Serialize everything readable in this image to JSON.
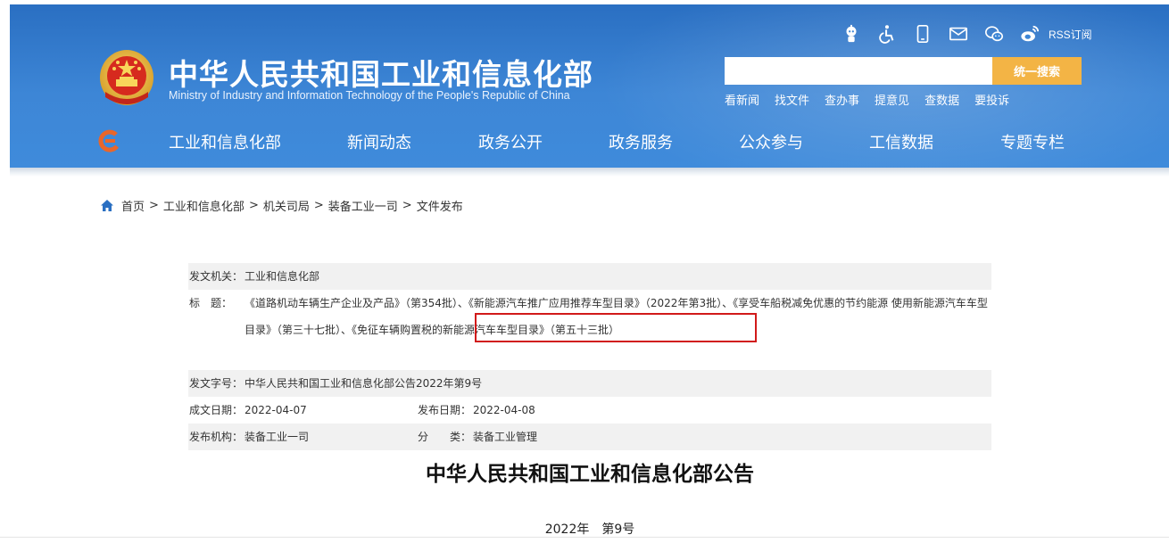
{
  "header": {
    "site_title": "中华人民共和国工业和信息化部",
    "site_subtitle": "Ministry of Industry and Information Technology of the People's Republic of China",
    "tool_icons": [
      "robot-assistant-icon",
      "accessibility-icon",
      "mobile-icon",
      "mail-icon",
      "wechat-icon",
      "weibo-icon"
    ],
    "rss_label": "RSS订阅",
    "search": {
      "placeholder": "",
      "button_label": "统一搜索"
    },
    "quick_links": [
      "看新闻",
      "找文件",
      "查办事",
      "提意见",
      "查数据",
      "要投诉"
    ],
    "nav_items": [
      "工业和信息化部",
      "新闻动态",
      "政务公开",
      "政务服务",
      "公众参与",
      "工信数据",
      "专题专栏"
    ],
    "colors": {
      "header_blue": "#3d86d6",
      "search_button": "#f3b445",
      "highlight_red": "#d11a1a"
    }
  },
  "breadcrumb": {
    "items": [
      "首页",
      "工业和信息化部",
      "机关司局",
      "装备工业一司",
      "文件发布"
    ],
    "separator": ">"
  },
  "info": {
    "issuer_label": "发文机关：",
    "issuer_value": "工业和信息化部",
    "title_label": "标　题：",
    "title_part1": "《道路机动车辆生产企业及产品》（第354批）、",
    "title_highlight": "《新能源汽车推广应用推荐车型目录》（2022年第3批）",
    "title_part2": "、《享受车船税减免优惠的节约能源 使用新能源汽车车型目录》（第三十七批）、《免征车辆购置税的新能源汽车车型目录》（第五十三批）",
    "doc_number_label": "发文字号：",
    "doc_number_value": "中华人民共和国工业和信息化部公告2022年第9号",
    "written_date_label": "成文日期：",
    "written_date_value": "2022-04-07",
    "publish_date_label": "发布日期：",
    "publish_date_value": "2022-04-08",
    "org_label": "发布机构：",
    "org_value": "装备工业一司",
    "category_label": "分　　类：",
    "category_value": "装备工业管理"
  },
  "document": {
    "title": "中华人民共和国工业和信息化部公告",
    "number": "2022年　第9号"
  }
}
